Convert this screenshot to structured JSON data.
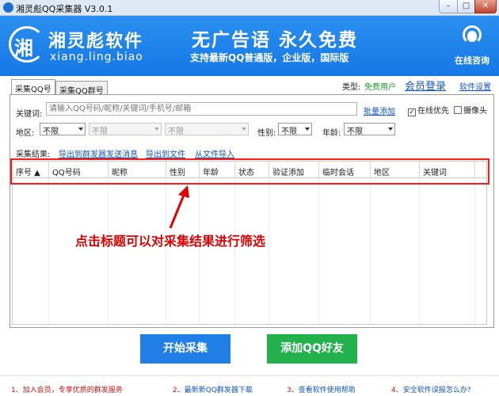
{
  "window": {
    "title": "湘灵彪QQ采集器 V3.0.1",
    "minimize": "–",
    "maximize": "□",
    "close": "✕"
  },
  "banner": {
    "logo_glyph": "湘",
    "brand_name": "湘灵彪软件",
    "brand_url": "xiang.ling.biao",
    "slogan": "无广告语  永久免费",
    "slogan_sub": "支持最新QQ普通版，企业版，国际版",
    "support_label": "在线咨询"
  },
  "tabs": [
    {
      "label": "采集QQ号",
      "active": true
    },
    {
      "label": "采集QQ群号",
      "active": false
    }
  ],
  "account": {
    "type_label": "类型:",
    "type_value": "免费用户",
    "member_login": "会员登录",
    "settings": "软件设置"
  },
  "keywords": {
    "label": "关键词:",
    "placeholder": "请输入QQ号码/昵称/关键词/手机号/邮箱",
    "batch_add": "批量添加",
    "online_first": "在线优先",
    "online_first_checked": true,
    "camera": "摄像头",
    "camera_checked": false
  },
  "filters": {
    "region_label": "地区:",
    "region1": "不限",
    "region2": "不限",
    "region3": "不限",
    "gender_label": "性别:",
    "gender": "不限",
    "age_label": "年龄:",
    "age": "不限"
  },
  "results": {
    "label": "采集结果:",
    "export_sender": "导出到群发器发送消息",
    "export_file": "导出到文件",
    "import_file": "从文件导入"
  },
  "table": {
    "columns": [
      "序号 ▲",
      "QQ号码",
      "昵称",
      "性别",
      "年龄",
      "状态",
      "验证添加",
      "临时会话",
      "地区",
      "关键词"
    ],
    "rows": []
  },
  "annotation": "点击标题可以对采集结果进行筛选",
  "actions": {
    "start": "开始采集",
    "add_friend": "添加QQ好友"
  },
  "footer": [
    {
      "num": "1、",
      "text": "加入会员，专享优质的群发服务"
    },
    {
      "num": "2、",
      "text": "最新新QQ群发器下载"
    },
    {
      "num": "3、",
      "text": "查看软件使用帮助"
    },
    {
      "num": "4、",
      "text": "安全软件误报怎么办?"
    }
  ],
  "colors": {
    "banner_blue": "#1f7fe6",
    "start_button": "#1f7fe6",
    "add_button": "#22b14c",
    "annotation_red": "#e00000",
    "user_type_green": "#1a9c2a"
  }
}
